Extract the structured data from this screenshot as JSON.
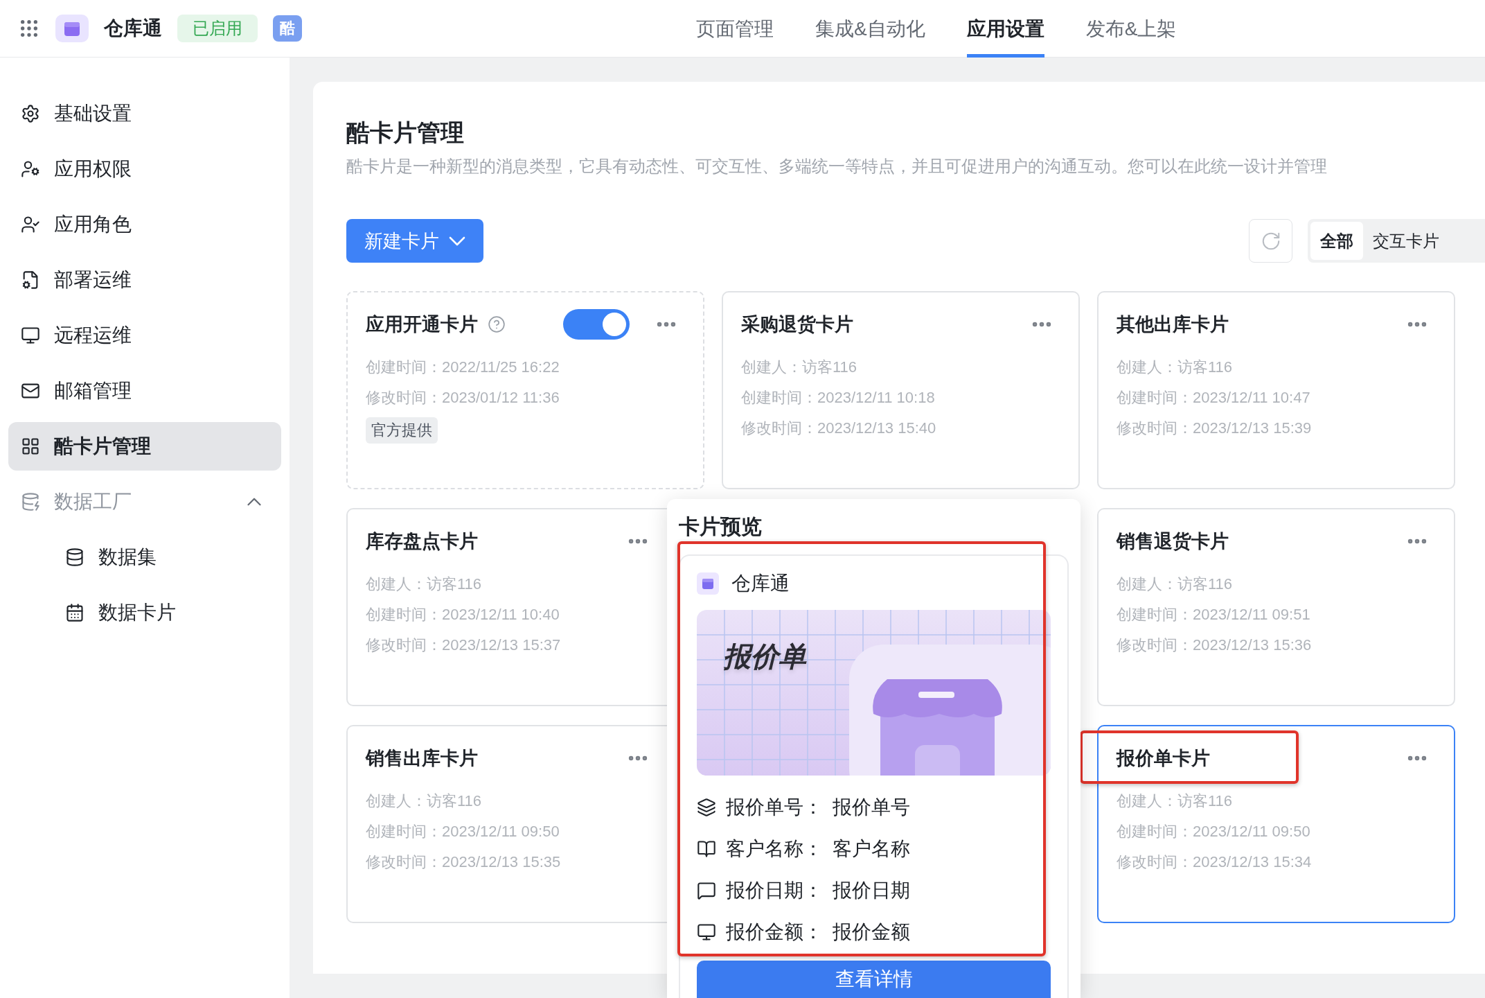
{
  "header": {
    "app_name": "仓库通",
    "status_badge": "已启用",
    "mini_badge": "酷",
    "tabs": [
      {
        "label": "页面管理",
        "selected": false
      },
      {
        "label": "集成&自动化",
        "selected": false
      },
      {
        "label": "应用设置",
        "selected": true
      },
      {
        "label": "发布&上架",
        "selected": false
      }
    ]
  },
  "sidebar": {
    "items": [
      {
        "label": "基础设置",
        "selected": false
      },
      {
        "label": "应用权限",
        "selected": false
      },
      {
        "label": "应用角色",
        "selected": false
      },
      {
        "label": "部署运维",
        "selected": false
      },
      {
        "label": "远程运维",
        "selected": false
      },
      {
        "label": "邮箱管理",
        "selected": false
      },
      {
        "label": "酷卡片管理",
        "selected": true
      },
      {
        "label": "数据工厂",
        "selected": false,
        "expanded": true,
        "children": [
          {
            "label": "数据集",
            "selected": false
          },
          {
            "label": "数据卡片",
            "selected": false
          }
        ]
      }
    ]
  },
  "page": {
    "title": "酷卡片管理",
    "description": "酷卡片是一种新型的消息类型，它具有动态性、可交互性、多端统一等特点，并且可促进用户的沟通互动。您可以在此统一设计并管理",
    "new_button": "新建卡片",
    "filter_tabs": [
      {
        "label": "全部",
        "selected": true
      },
      {
        "label": "交互卡片",
        "selected": false
      }
    ]
  },
  "rows": [
    {
      "cards": [
        {
          "kind": "official",
          "title": "应用开通卡片",
          "on": true,
          "meta": [
            "创建时间：2022/11/25 16:22",
            "修改时间：2023/01/12 11:36"
          ],
          "tag": "官方提供",
          "selected": false,
          "highlighted": false
        },
        {
          "kind": "custom",
          "title": "采购退货卡片",
          "meta": [
            "创建人：访客116",
            "创建时间：2023/12/11 10:18",
            "修改时间：2023/12/13 15:40"
          ],
          "selected": false,
          "highlighted": false
        },
        {
          "kind": "custom",
          "title": "其他出库卡片",
          "meta": [
            "创建人：访客116",
            "创建时间：2023/12/11 10:47",
            "修改时间：2023/12/13 15:39"
          ],
          "selected": false,
          "highlighted": false
        }
      ]
    },
    {
      "cards": [
        {
          "kind": "custom",
          "title": "库存盘点卡片",
          "meta": [
            "创建人：访客116",
            "创建时间：2023/12/11 10:40",
            "修改时间：2023/12/13 15:37"
          ],
          "selected": false,
          "highlighted": false
        },
        {
          "kind": "custom",
          "title": "销售退货卡片",
          "meta": [
            "创建人：访客116",
            "创建时间：2023/12/11 09:51",
            "修改时间：2023/12/13 15:36"
          ],
          "selected": false,
          "highlighted": false
        }
      ]
    },
    {
      "cards": [
        {
          "kind": "custom",
          "title": "销售出库卡片",
          "meta": [
            "创建人：访客116",
            "创建时间：2023/12/11 09:50",
            "修改时间：2023/12/13 15:35"
          ],
          "selected": false,
          "highlighted": false
        },
        {
          "kind": "custom",
          "title": "报价单卡片",
          "meta": [
            "创建人：访客116",
            "创建时间：2023/12/11 09:50",
            "修改时间：2023/12/13 15:34"
          ],
          "selected": true,
          "highlighted": true
        }
      ]
    }
  ],
  "preview": {
    "title": "卡片预览",
    "app_name": "仓库通",
    "banner_title": "报价单",
    "highlighted": true,
    "fields": [
      {
        "label": "报价单号：",
        "value": "报价单号"
      },
      {
        "label": "客户名称：",
        "value": "客户名称"
      },
      {
        "label": "报价日期：",
        "value": "报价日期"
      },
      {
        "label": "报价金额：",
        "value": "报价金额"
      }
    ],
    "button": "查看详情"
  }
}
